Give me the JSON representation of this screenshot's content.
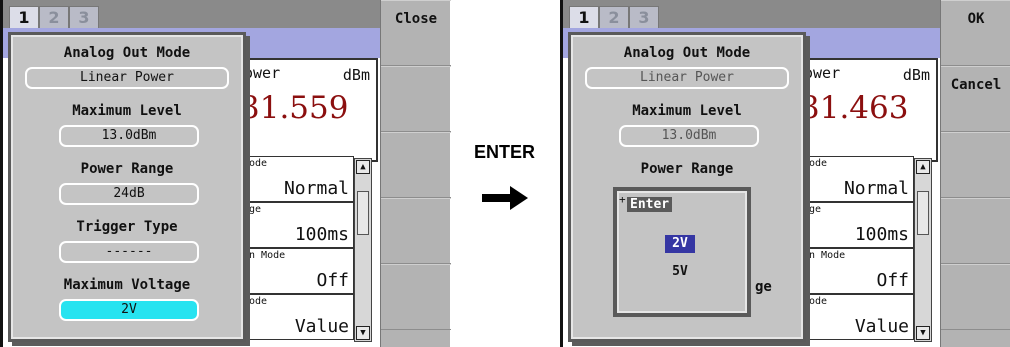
{
  "transition": {
    "label": "ENTER",
    "arrow_icon": "right-arrow-icon"
  },
  "left": {
    "tabs": [
      "1",
      "2",
      "3"
    ],
    "readout": {
      "label": "ower",
      "unit": "dBm",
      "value": "31.559"
    },
    "cells": [
      {
        "label": "Mode",
        "value": "Normal"
      },
      {
        "label": "age",
        "value": "100ms"
      },
      {
        "label": "in Mode",
        "value": "Off"
      },
      {
        "label": "Mode",
        "value": "Value"
      }
    ],
    "softkeys": [
      "Close",
      "",
      "",
      "",
      ""
    ],
    "dialog": {
      "analog_out_mode_label": "Analog Out Mode",
      "analog_out_mode_value": "Linear Power",
      "maximum_level_label": "Maximum Level",
      "maximum_level_value": "13.0dBm",
      "power_range_label": "Power Range",
      "power_range_value": "24dB",
      "trigger_type_label": "Trigger Type",
      "trigger_type_value": "------",
      "maximum_voltage_label": "Maximum Voltage",
      "maximum_voltage_value": "2V"
    }
  },
  "right": {
    "tabs": [
      "1",
      "2",
      "3"
    ],
    "readout": {
      "label": "ower",
      "unit": "dBm",
      "value": "31.463"
    },
    "cells": [
      {
        "label": "Mode",
        "value": "Normal"
      },
      {
        "label": "age",
        "value": "100ms"
      },
      {
        "label": "in Mode",
        "value": "Off"
      },
      {
        "label": "Mode",
        "value": "Value"
      }
    ],
    "softkeys": [
      "OK",
      "Cancel",
      "",
      "",
      ""
    ],
    "dialog": {
      "analog_out_mode_label": "Analog Out Mode",
      "analog_out_mode_value": "Linear Power",
      "maximum_level_label": "Maximum Level",
      "maximum_level_value": "13.0dBm",
      "power_range_label": "Power Range",
      "partial_label_under_popup": "ge"
    },
    "popup": {
      "title": "Enter",
      "plus": "+",
      "options": [
        "2V",
        "5V"
      ],
      "selected": "2V"
    }
  },
  "colors": {
    "selected_field": "#27e3f0",
    "selected_option": "#3536a3",
    "readout_value": "#8b0f0f",
    "header_strip": "#a3a6e0"
  }
}
